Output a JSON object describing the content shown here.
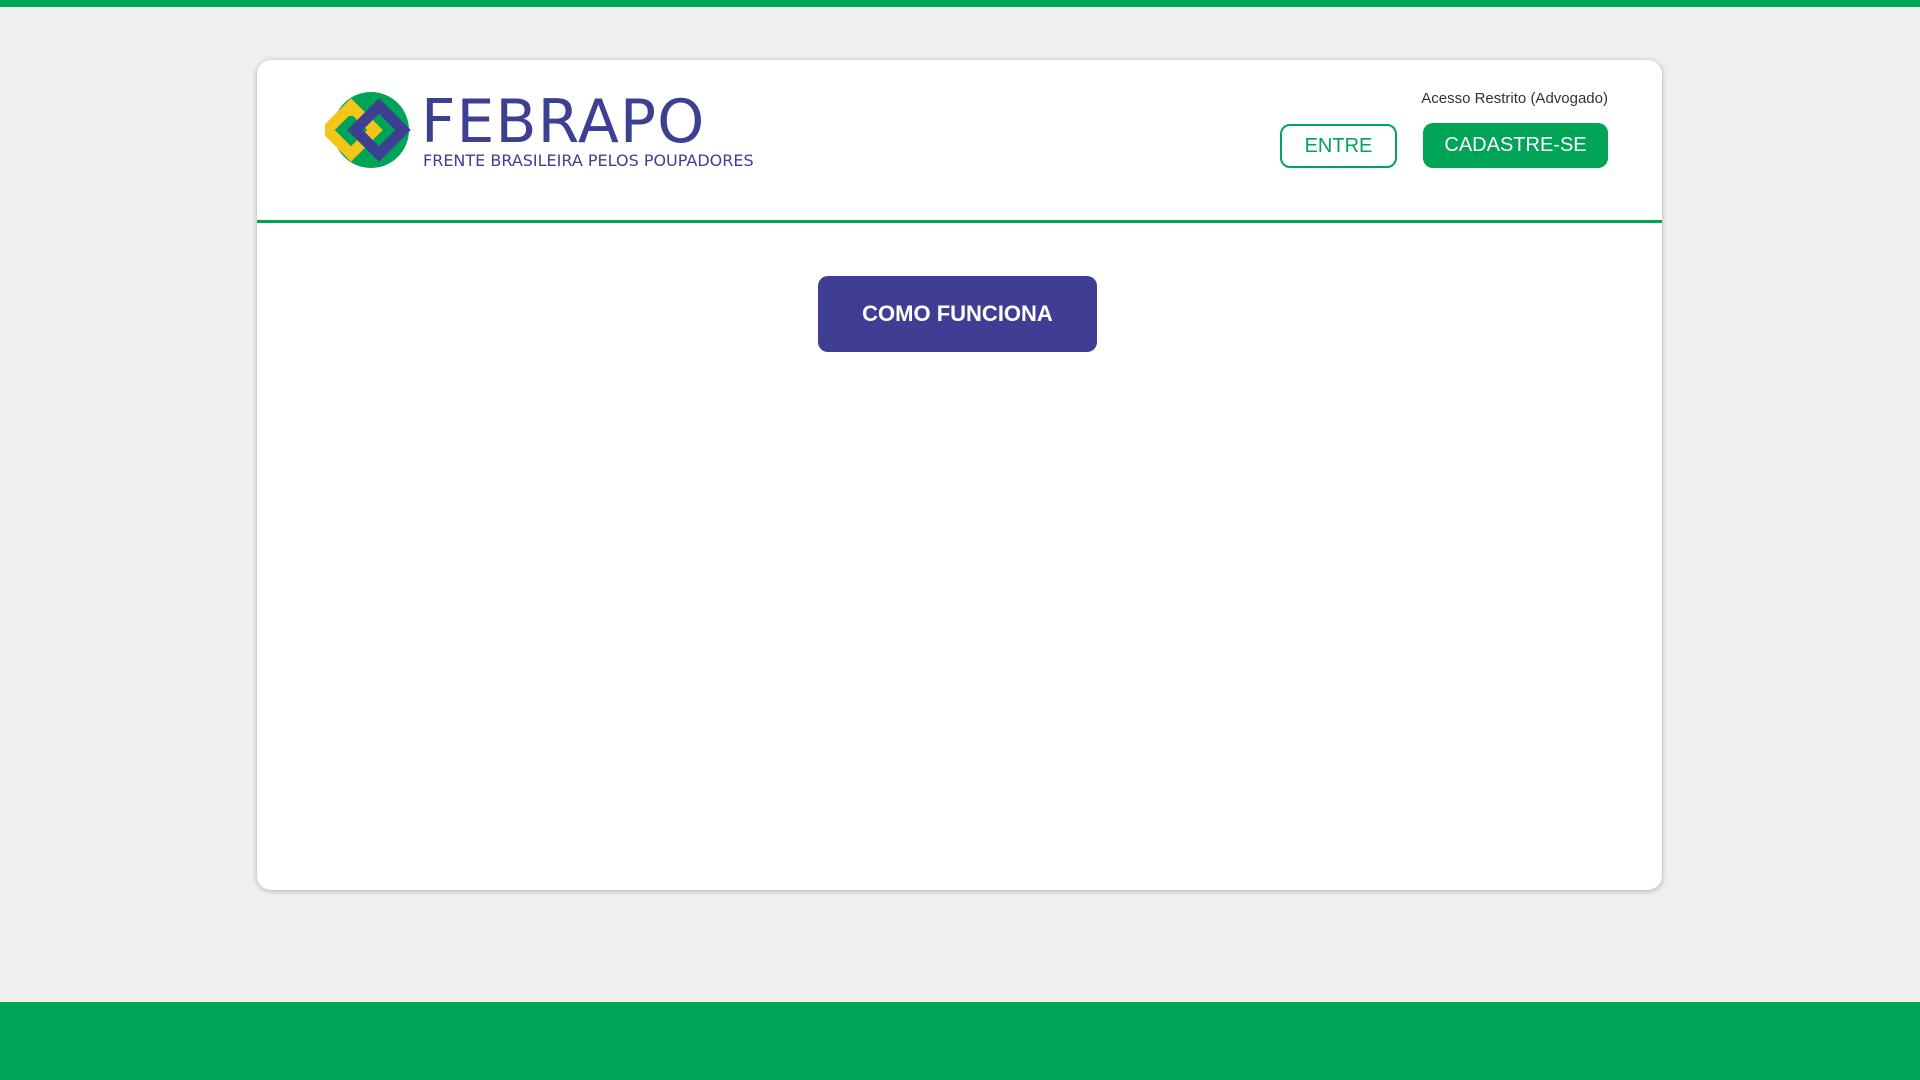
{
  "brand": {
    "name": "FEBRAPO",
    "tagline": "FRENTE BRASILEIRA PELOS POUPADORES",
    "colors": {
      "green": "#00a457",
      "indigo": "#3d3f93",
      "yellow": "#f5c518"
    }
  },
  "header": {
    "restricted_label": "Acesso Restrito (Advogado)",
    "login_label": "ENTRE",
    "register_label": "CADASTRE-SE"
  },
  "main": {
    "how_it_works_label": "COMO FUNCIONA"
  }
}
